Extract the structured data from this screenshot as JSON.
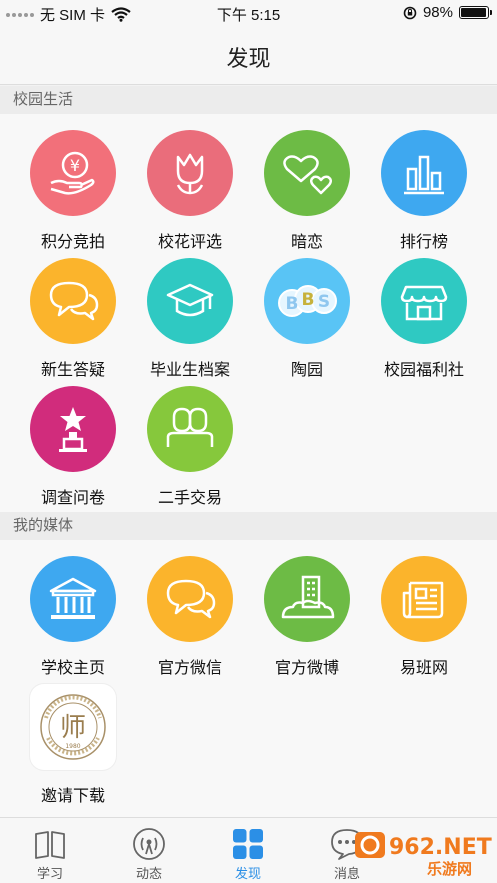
{
  "status_bar": {
    "carrier": "无 SIM 卡",
    "time": "下午 5:15",
    "battery_text": "98%",
    "battery_level": 0.98,
    "icons": [
      "signal-dots-icon",
      "wifi-icon",
      "orientation-lock-icon",
      "battery-icon"
    ]
  },
  "nav": {
    "title": "发现"
  },
  "sections": [
    {
      "title": "校园生活",
      "items": [
        {
          "label": "积分竞拍",
          "icon": "yen-hand-icon",
          "color": "#f2707a"
        },
        {
          "label": "校花评选",
          "icon": "tulip-icon",
          "color": "#ea6d7b"
        },
        {
          "label": "暗恋",
          "icon": "hearts-icon",
          "color": "#6dbb45"
        },
        {
          "label": "排行榜",
          "icon": "bar-chart-icon",
          "color": "#3ea8f0"
        },
        {
          "label": "新生答疑",
          "icon": "chat-bubbles-icon",
          "color": "#fbb42c"
        },
        {
          "label": "毕业生档案",
          "icon": "graduation-cap-icon",
          "color": "#2fc9c2"
        },
        {
          "label": "陶园",
          "icon": "bbs-icon",
          "color": "#59c4f5"
        },
        {
          "label": "校园福利社",
          "icon": "shop-icon",
          "color": "#2fc9c2"
        },
        {
          "label": "调查问卷",
          "icon": "trophy-star-icon",
          "color": "#d12c7c"
        },
        {
          "label": "二手交易",
          "icon": "people-icon",
          "color": "#86c83c"
        }
      ]
    },
    {
      "title": "我的媒体",
      "items": [
        {
          "label": "学校主页",
          "icon": "building-columns-icon",
          "color": "#3ea8f0"
        },
        {
          "label": "官方微信",
          "icon": "chat-bubbles-icon",
          "color": "#fbb42c"
        },
        {
          "label": "官方微博",
          "icon": "city-building-icon",
          "color": "#6dbb45"
        },
        {
          "label": "易班网",
          "icon": "newspaper-icon",
          "color": "#fbb42c"
        },
        {
          "label": "邀请下载",
          "icon": "school-logo-icon",
          "color": "#ffffff",
          "logo_char": "师",
          "logo_year": "1980"
        }
      ]
    }
  ],
  "tabs": [
    {
      "label": "学习",
      "icon": "book-icon",
      "active": false
    },
    {
      "label": "动态",
      "icon": "broadcast-icon",
      "active": false
    },
    {
      "label": "发现",
      "icon": "grid-icon",
      "active": true
    },
    {
      "label": "消息",
      "icon": "message-icon",
      "active": false
    }
  ],
  "watermark": {
    "text": "962.NET",
    "sub": "乐游网"
  }
}
